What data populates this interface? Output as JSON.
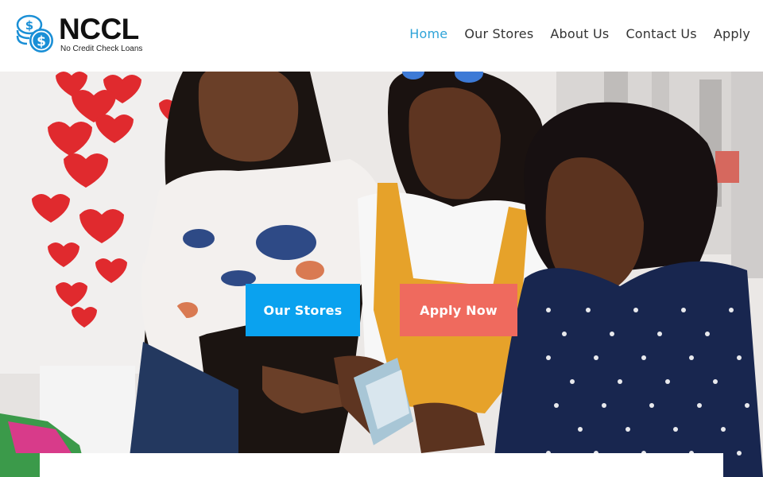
{
  "brand": {
    "name": "NCCL",
    "tagline": "No Credit Check Loans",
    "icon": "dollar-coins-icon",
    "accent_color": "#2ea3d8"
  },
  "nav": {
    "items": [
      {
        "label": "Home",
        "active": true
      },
      {
        "label": "Our Stores",
        "active": false
      },
      {
        "label": "About Us",
        "active": false
      },
      {
        "label": "Contact Us",
        "active": false
      },
      {
        "label": "Apply",
        "active": false
      }
    ]
  },
  "hero": {
    "image": "three-women-counting-money-photo",
    "buttons": {
      "stores_label": "Our Stores",
      "stores_color": "#0aa2ef",
      "apply_label": "Apply Now",
      "apply_color": "#ef6a5e"
    }
  }
}
